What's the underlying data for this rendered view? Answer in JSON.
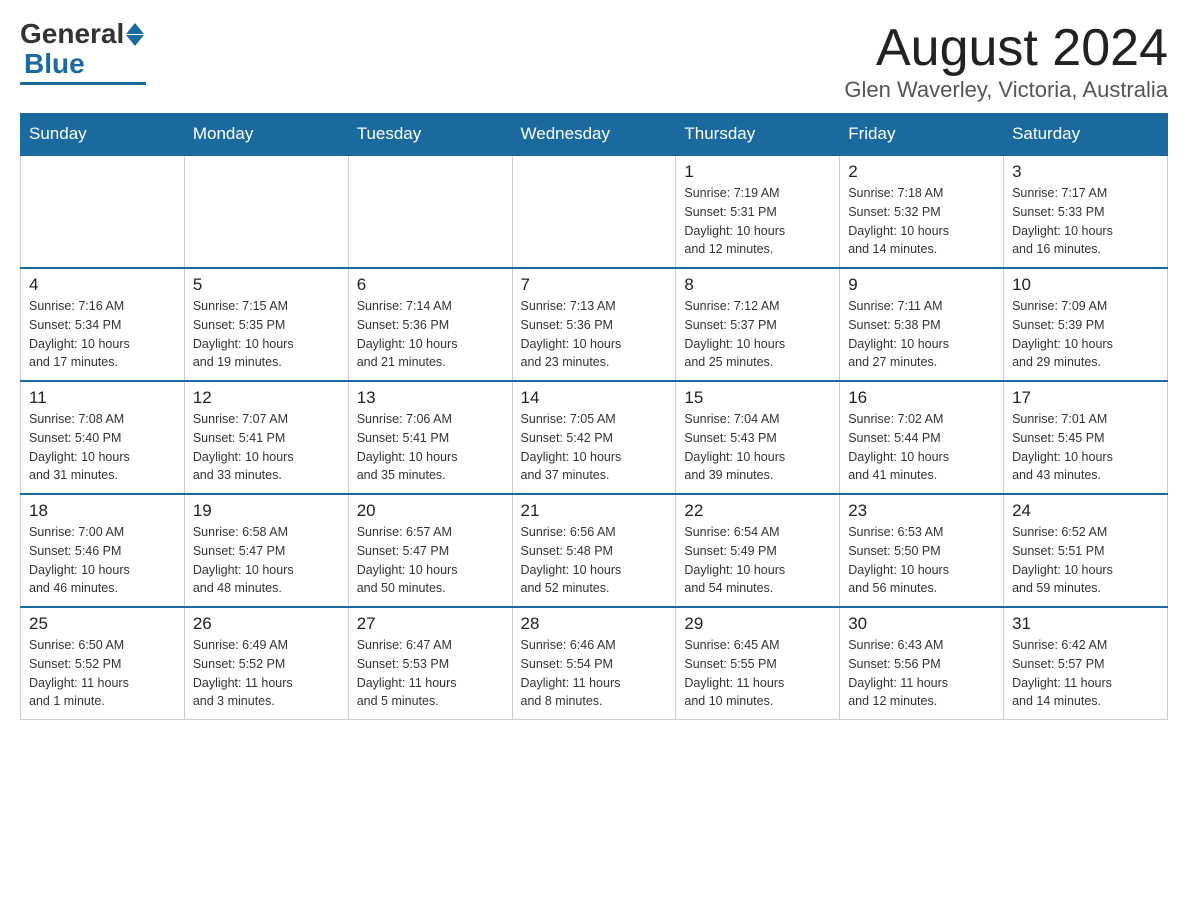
{
  "header": {
    "logo_general": "General",
    "logo_blue": "Blue",
    "month_year": "August 2024",
    "location": "Glen Waverley, Victoria, Australia"
  },
  "days_of_week": [
    "Sunday",
    "Monday",
    "Tuesday",
    "Wednesday",
    "Thursday",
    "Friday",
    "Saturday"
  ],
  "weeks": [
    [
      {
        "day": "",
        "info": ""
      },
      {
        "day": "",
        "info": ""
      },
      {
        "day": "",
        "info": ""
      },
      {
        "day": "",
        "info": ""
      },
      {
        "day": "1",
        "info": "Sunrise: 7:19 AM\nSunset: 5:31 PM\nDaylight: 10 hours\nand 12 minutes."
      },
      {
        "day": "2",
        "info": "Sunrise: 7:18 AM\nSunset: 5:32 PM\nDaylight: 10 hours\nand 14 minutes."
      },
      {
        "day": "3",
        "info": "Sunrise: 7:17 AM\nSunset: 5:33 PM\nDaylight: 10 hours\nand 16 minutes."
      }
    ],
    [
      {
        "day": "4",
        "info": "Sunrise: 7:16 AM\nSunset: 5:34 PM\nDaylight: 10 hours\nand 17 minutes."
      },
      {
        "day": "5",
        "info": "Sunrise: 7:15 AM\nSunset: 5:35 PM\nDaylight: 10 hours\nand 19 minutes."
      },
      {
        "day": "6",
        "info": "Sunrise: 7:14 AM\nSunset: 5:36 PM\nDaylight: 10 hours\nand 21 minutes."
      },
      {
        "day": "7",
        "info": "Sunrise: 7:13 AM\nSunset: 5:36 PM\nDaylight: 10 hours\nand 23 minutes."
      },
      {
        "day": "8",
        "info": "Sunrise: 7:12 AM\nSunset: 5:37 PM\nDaylight: 10 hours\nand 25 minutes."
      },
      {
        "day": "9",
        "info": "Sunrise: 7:11 AM\nSunset: 5:38 PM\nDaylight: 10 hours\nand 27 minutes."
      },
      {
        "day": "10",
        "info": "Sunrise: 7:09 AM\nSunset: 5:39 PM\nDaylight: 10 hours\nand 29 minutes."
      }
    ],
    [
      {
        "day": "11",
        "info": "Sunrise: 7:08 AM\nSunset: 5:40 PM\nDaylight: 10 hours\nand 31 minutes."
      },
      {
        "day": "12",
        "info": "Sunrise: 7:07 AM\nSunset: 5:41 PM\nDaylight: 10 hours\nand 33 minutes."
      },
      {
        "day": "13",
        "info": "Sunrise: 7:06 AM\nSunset: 5:41 PM\nDaylight: 10 hours\nand 35 minutes."
      },
      {
        "day": "14",
        "info": "Sunrise: 7:05 AM\nSunset: 5:42 PM\nDaylight: 10 hours\nand 37 minutes."
      },
      {
        "day": "15",
        "info": "Sunrise: 7:04 AM\nSunset: 5:43 PM\nDaylight: 10 hours\nand 39 minutes."
      },
      {
        "day": "16",
        "info": "Sunrise: 7:02 AM\nSunset: 5:44 PM\nDaylight: 10 hours\nand 41 minutes."
      },
      {
        "day": "17",
        "info": "Sunrise: 7:01 AM\nSunset: 5:45 PM\nDaylight: 10 hours\nand 43 minutes."
      }
    ],
    [
      {
        "day": "18",
        "info": "Sunrise: 7:00 AM\nSunset: 5:46 PM\nDaylight: 10 hours\nand 46 minutes."
      },
      {
        "day": "19",
        "info": "Sunrise: 6:58 AM\nSunset: 5:47 PM\nDaylight: 10 hours\nand 48 minutes."
      },
      {
        "day": "20",
        "info": "Sunrise: 6:57 AM\nSunset: 5:47 PM\nDaylight: 10 hours\nand 50 minutes."
      },
      {
        "day": "21",
        "info": "Sunrise: 6:56 AM\nSunset: 5:48 PM\nDaylight: 10 hours\nand 52 minutes."
      },
      {
        "day": "22",
        "info": "Sunrise: 6:54 AM\nSunset: 5:49 PM\nDaylight: 10 hours\nand 54 minutes."
      },
      {
        "day": "23",
        "info": "Sunrise: 6:53 AM\nSunset: 5:50 PM\nDaylight: 10 hours\nand 56 minutes."
      },
      {
        "day": "24",
        "info": "Sunrise: 6:52 AM\nSunset: 5:51 PM\nDaylight: 10 hours\nand 59 minutes."
      }
    ],
    [
      {
        "day": "25",
        "info": "Sunrise: 6:50 AM\nSunset: 5:52 PM\nDaylight: 11 hours\nand 1 minute."
      },
      {
        "day": "26",
        "info": "Sunrise: 6:49 AM\nSunset: 5:52 PM\nDaylight: 11 hours\nand 3 minutes."
      },
      {
        "day": "27",
        "info": "Sunrise: 6:47 AM\nSunset: 5:53 PM\nDaylight: 11 hours\nand 5 minutes."
      },
      {
        "day": "28",
        "info": "Sunrise: 6:46 AM\nSunset: 5:54 PM\nDaylight: 11 hours\nand 8 minutes."
      },
      {
        "day": "29",
        "info": "Sunrise: 6:45 AM\nSunset: 5:55 PM\nDaylight: 11 hours\nand 10 minutes."
      },
      {
        "day": "30",
        "info": "Sunrise: 6:43 AM\nSunset: 5:56 PM\nDaylight: 11 hours\nand 12 minutes."
      },
      {
        "day": "31",
        "info": "Sunrise: 6:42 AM\nSunset: 5:57 PM\nDaylight: 11 hours\nand 14 minutes."
      }
    ]
  ]
}
